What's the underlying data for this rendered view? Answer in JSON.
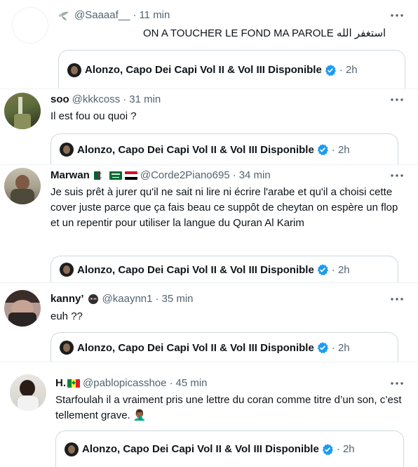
{
  "tweets": [
    {
      "handle": "@Saaaaf__",
      "time": "11 min",
      "text": "ON A TOUCHER LE FOND MA PAROLE استغفر الله",
      "quote_author": "Alonzo, Capo Dei Capi Vol II & Vol III Disponible",
      "quote_time": "· 2h"
    },
    {
      "name": "soo",
      "handle": "@kkkcoss",
      "time": "31 min",
      "text": "Il est fou ou quoi ?",
      "quote_author": "Alonzo, Capo Dei Capi Vol II & Vol III Disponible",
      "quote_time": "· 2h"
    },
    {
      "name": "Marwan",
      "handle": "@Corde2Piano695",
      "time": "34 min",
      "text": "Je suis prêt à jurer qu'il ne sait ni lire ni écrire l'arabe et qu'il a choisi cette cover juste parce que ça fais beau ce suppôt de cheytan on espère un flop et un repentir pour utiliser la langue du Quran Al Karim",
      "quote_author": "Alonzo, Capo Dei Capi Vol II & Vol III Disponible",
      "quote_time": "· 2h"
    },
    {
      "name": "kanny’",
      "handle": "@kaaynn1",
      "time": "35 min",
      "text": "euh ??",
      "quote_author": "Alonzo, Capo Dei Capi Vol II & Vol III Disponible",
      "quote_time": "· 2h"
    },
    {
      "name": "H.",
      "handle": "@pablopicasshoe",
      "time": "45 min",
      "text": "Starfoulah il a vraiment pris une lettre du coran comme titre d’un son, c’est tellement grave. 🤦🏾‍♂️",
      "quote_author": "Alonzo, Capo Dei Capi Vol II & Vol III Disponible",
      "quote_time": "· 2h"
    }
  ],
  "icons": {
    "more": "more-icon",
    "verified": "verified-badge-icon",
    "emoji_dove": "dove-emoji-icon",
    "emoji_ninja": "ninja-emoji-icon"
  },
  "colors": {
    "accent": "#1d9bf0",
    "muted": "#536471",
    "border": "#cfd9de",
    "separator": "#eff3f4"
  }
}
